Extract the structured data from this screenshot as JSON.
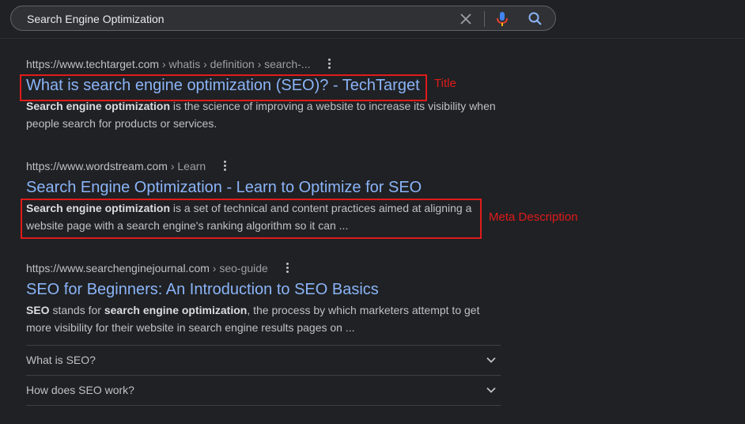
{
  "search": {
    "query": "Search Engine Optimization"
  },
  "results": [
    {
      "url_base": "https://www.techtarget.com",
      "url_crumbs": " › whatis › definition › search-...",
      "title": "What is search engine optimization (SEO)? - TechTarget",
      "snippet_bold": "Search engine optimization",
      "snippet_rest": " is the science of improving a website to increase its visibility when people search for products or services."
    },
    {
      "url_base": "https://www.wordstream.com",
      "url_crumbs": " › Learn",
      "title": "Search Engine Optimization - Learn to Optimize for SEO",
      "snippet_bold": "Search engine optimization",
      "snippet_rest": " is a set of technical and content practices aimed at aligning a website page with a search engine's ranking algorithm so it can ..."
    },
    {
      "url_base": "https://www.searchenginejournal.com",
      "url_crumbs": " › seo-guide",
      "title": "SEO for Beginners: An Introduction to SEO Basics",
      "snippet_b1": "SEO",
      "snippet_t1": " stands for ",
      "snippet_b2": "search engine optimization",
      "snippet_t2": ", the process by which marketers attempt to get more visibility for their website in search engine results pages on ..."
    }
  ],
  "faq": [
    "What is SEO?",
    "How does SEO work?"
  ],
  "annotations": {
    "title_label": "Title",
    "meta_label": "Meta Description"
  },
  "colors": {
    "annotation": "#e01b1b",
    "link": "#8ab4f8",
    "background": "#202124"
  }
}
